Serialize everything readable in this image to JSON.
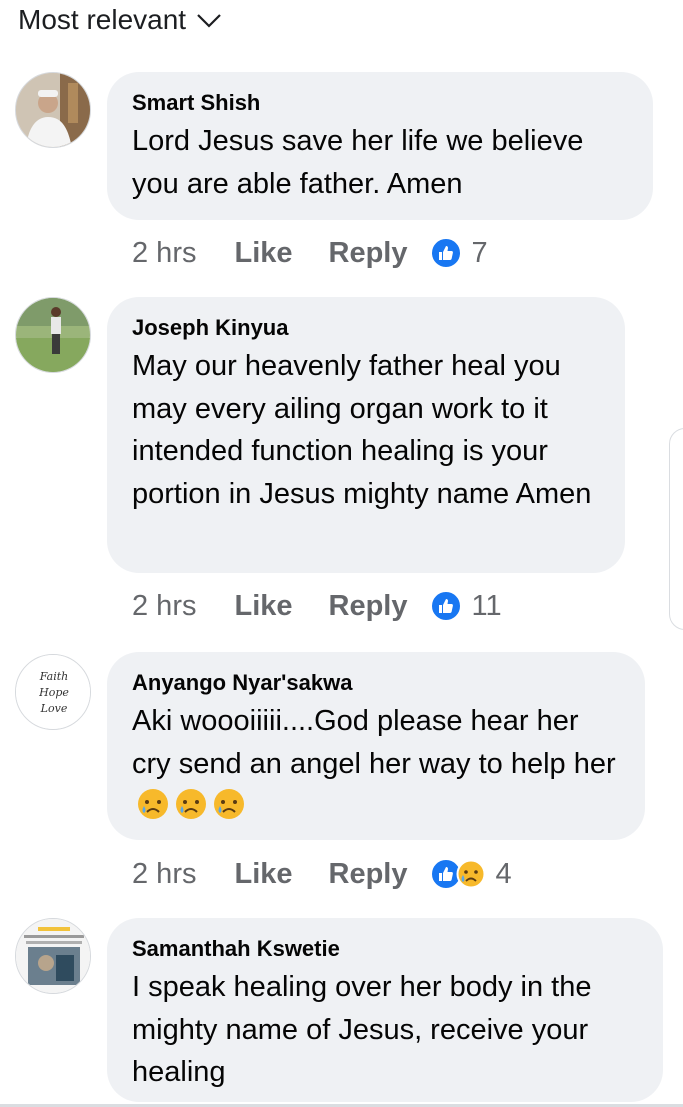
{
  "sort": {
    "label": "Most relevant"
  },
  "comments": [
    {
      "author": "Smart Shish",
      "text": "Lord Jesus save her life we believe you are able father. Amen",
      "time": "2 hrs",
      "like_label": "Like",
      "reply_label": "Reply",
      "reaction_count": "7",
      "reactions": [
        "like"
      ]
    },
    {
      "author": "Joseph Kinyua",
      "text": "May our heavenly father heal you may every ailing organ work to it intended function healing is your portion in Jesus mighty name Amen",
      "time": "2 hrs",
      "like_label": "Like",
      "reply_label": "Reply",
      "reaction_count": "11",
      "reactions": [
        "like"
      ]
    },
    {
      "author": "Anyango Nyar'sakwa",
      "text": "Aki woooiiiii....God please hear her cry send an angel her way to help her",
      "avatar_text": [
        "Faith",
        "Hope",
        "Love"
      ],
      "time": "2 hrs",
      "like_label": "Like",
      "reply_label": "Reply",
      "reaction_count": "4",
      "reactions": [
        "like",
        "sad"
      ]
    },
    {
      "author": "Samanthah Kswetie",
      "text": "I speak healing over her body in the mighty name of Jesus, receive your healing"
    }
  ],
  "colors": {
    "like_blue": "#1877f2",
    "bubble_bg": "#eff1f4",
    "meta_gray": "#65676b"
  }
}
